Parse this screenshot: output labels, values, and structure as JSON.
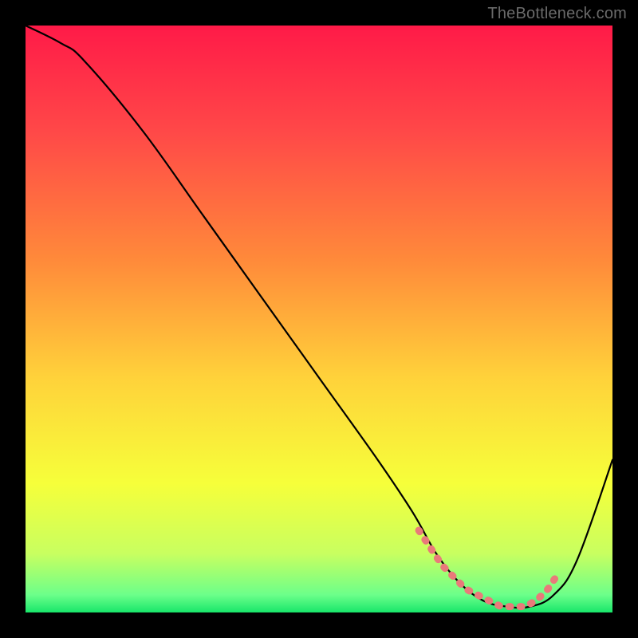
{
  "attribution": "TheBottleneck.com",
  "gradient": {
    "stops": [
      {
        "pos": 0,
        "color": "#ff1a48"
      },
      {
        "pos": 0.18,
        "color": "#ff4848"
      },
      {
        "pos": 0.4,
        "color": "#ff8a3a"
      },
      {
        "pos": 0.6,
        "color": "#ffd23a"
      },
      {
        "pos": 0.78,
        "color": "#f6ff3a"
      },
      {
        "pos": 0.9,
        "color": "#c8ff60"
      },
      {
        "pos": 0.965,
        "color": "#6cff8a"
      },
      {
        "pos": 1.0,
        "color": "#18e66a"
      }
    ]
  },
  "dots_color": "#e97a7a",
  "chart_data": {
    "type": "line",
    "title": "",
    "xlabel": "",
    "ylabel": "",
    "xlim": [
      0,
      100
    ],
    "ylim": [
      0,
      100
    ],
    "series": [
      {
        "name": "bottleneck-curve",
        "x": [
          0,
          6,
          10,
          20,
          30,
          40,
          50,
          60,
          66,
          70,
          74,
          78,
          82,
          86,
          90,
          94,
          100
        ],
        "values": [
          100,
          97,
          94,
          82,
          68,
          54,
          40,
          26,
          17,
          10,
          5,
          2,
          1,
          1,
          3,
          9,
          26
        ]
      },
      {
        "name": "optimal-region-dots",
        "x": [
          67,
          69,
          71,
          73,
          75,
          77,
          79,
          81,
          83,
          85,
          87,
          89,
          91
        ],
        "values": [
          14,
          11,
          8,
          6,
          4,
          3,
          2,
          1,
          1,
          1,
          2,
          4,
          7
        ]
      }
    ]
  }
}
